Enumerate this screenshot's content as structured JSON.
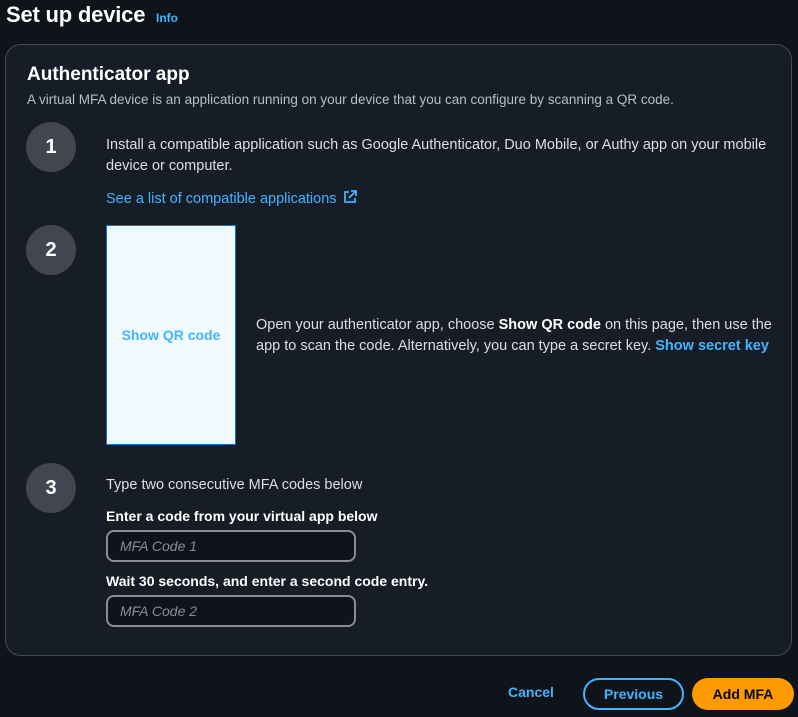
{
  "header": {
    "title": "Set up device",
    "info_label": "Info"
  },
  "panel": {
    "title": "Authenticator app",
    "description": "A virtual MFA device is an application running on your device that you can configure by scanning a QR code."
  },
  "steps": {
    "step1": {
      "number": "1",
      "text": "Install a compatible application such as Google Authenticator, Duo Mobile, or Authy app on your mobile device or computer.",
      "link_label": "See a list of compatible applications",
      "link_icon": "external-link-icon"
    },
    "step2": {
      "number": "2",
      "qr_button_label": "Show QR code",
      "text_before": "Open your authenticator app, choose ",
      "text_bold": "Show QR code",
      "text_after": " on this page, then use the app to scan the code. Alternatively, you can type a secret key. ",
      "secret_link_label": "Show secret key"
    },
    "step3": {
      "number": "3",
      "intro": "Type two consecutive MFA codes below",
      "field1_label": "Enter a code from your virtual app below",
      "field1_placeholder": "MFA Code 1",
      "field2_label": "Wait 30 seconds, and enter a second code entry.",
      "field2_placeholder": "MFA Code 2"
    }
  },
  "footer": {
    "cancel_label": "Cancel",
    "previous_label": "Previous",
    "add_label": "Add MFA"
  },
  "colors": {
    "background": "#0f141a",
    "panel": "#161d26",
    "link": "#42b4ff",
    "primary_button": "#ff9900",
    "step_circle": "#424650"
  }
}
